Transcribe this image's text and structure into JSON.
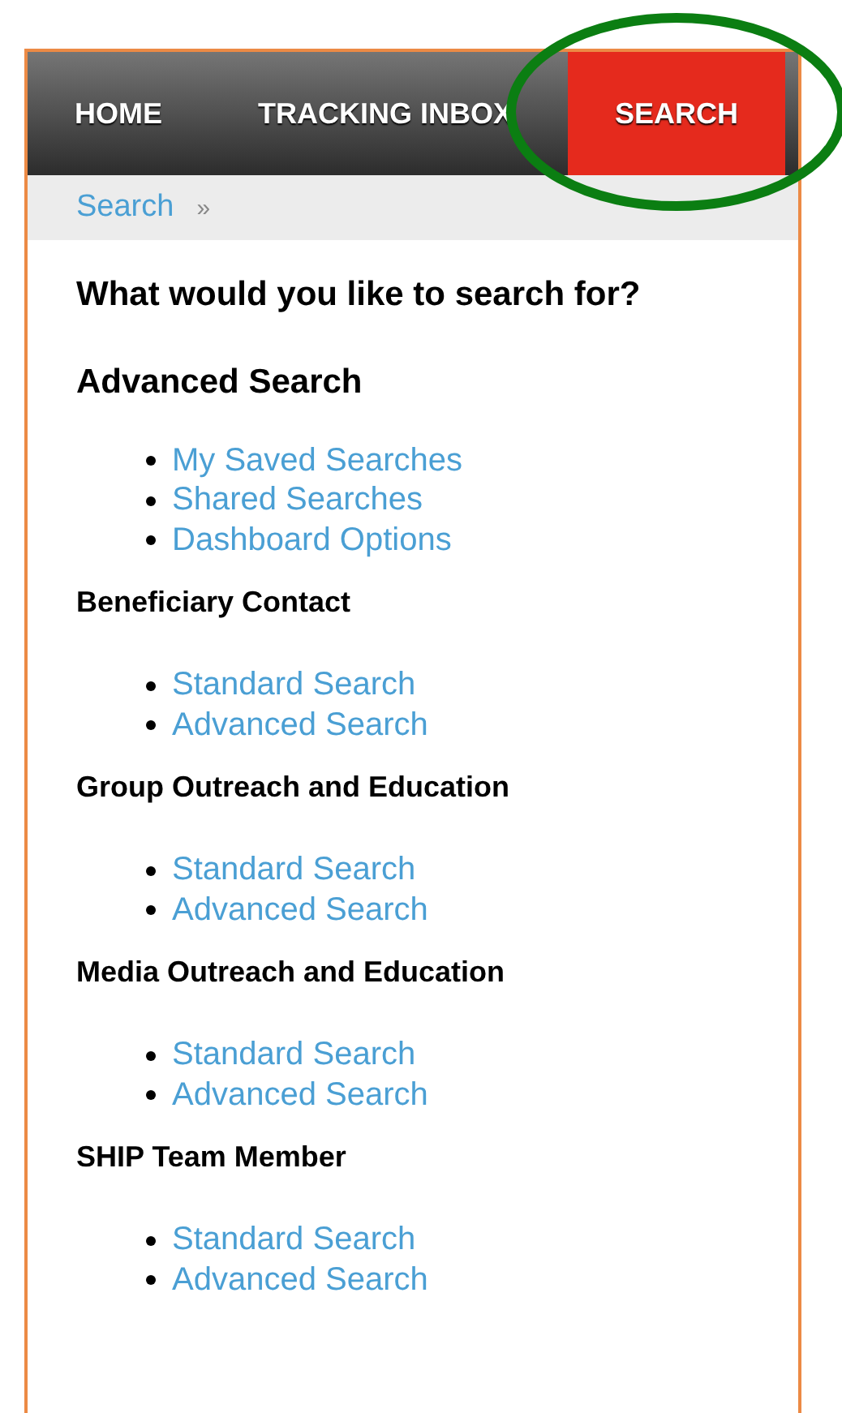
{
  "nav": {
    "tabs": [
      {
        "label": "HOME",
        "selected": false
      },
      {
        "label": "TRACKING INBOX",
        "selected": false
      },
      {
        "label": "SEARCH",
        "selected": true
      }
    ]
  },
  "breadcrumb": {
    "items": [
      {
        "label": "Search"
      }
    ],
    "separator": "»"
  },
  "title": "What would you like to search for?",
  "sections": [
    {
      "kind": "major",
      "heading": "Advanced Search",
      "links": [
        "My Saved Searches",
        "Shared Searches",
        "Dashboard Options"
      ]
    },
    {
      "kind": "minor",
      "heading": "Beneficiary Contact",
      "links": [
        "Standard Search",
        "Advanced Search"
      ]
    },
    {
      "kind": "minor",
      "heading": "Group Outreach and Education",
      "links": [
        "Standard Search",
        "Advanced Search"
      ]
    },
    {
      "kind": "minor",
      "heading": "Media Outreach and Education",
      "links": [
        "Standard Search",
        "Advanced Search"
      ]
    },
    {
      "kind": "minor",
      "heading": "SHIP Team Member",
      "links": [
        "Standard Search",
        "Advanced Search"
      ]
    }
  ],
  "annotation": {
    "kind": "ellipse"
  }
}
